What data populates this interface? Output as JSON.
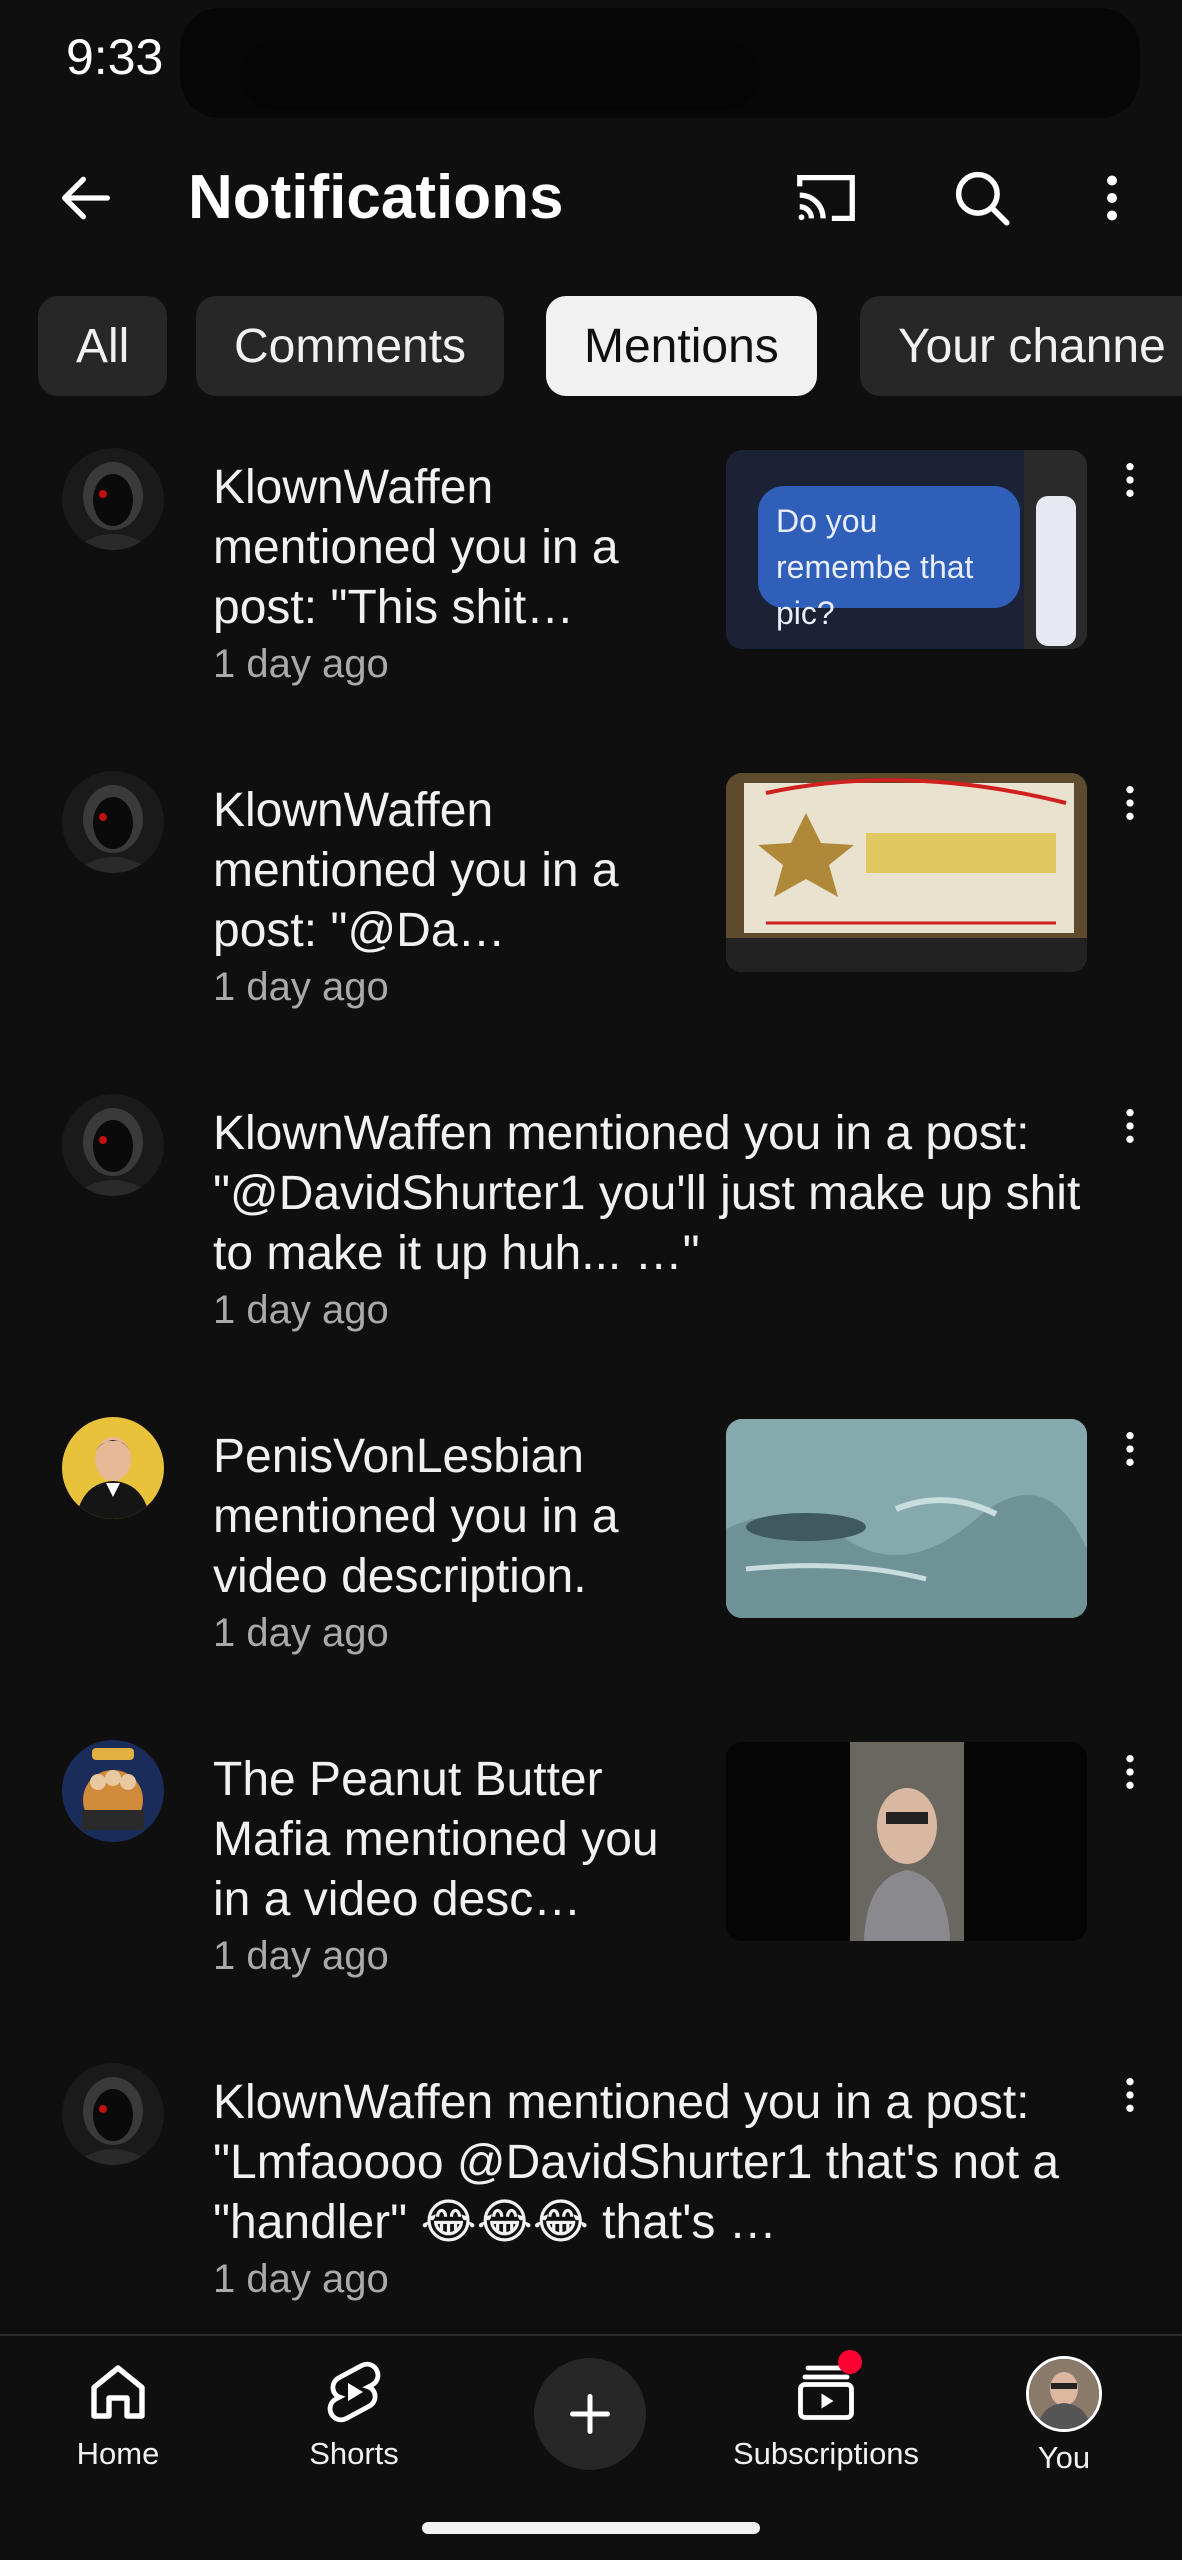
{
  "status_bar": {
    "time": "9:33"
  },
  "header": {
    "title": "Notifications",
    "icons": [
      "back-arrow-icon",
      "cast-icon",
      "search-icon",
      "more-vert-icon"
    ]
  },
  "tabs": [
    {
      "label": "All",
      "active": false
    },
    {
      "label": "Comments",
      "active": false
    },
    {
      "label": "Mentions",
      "active": true
    },
    {
      "label": "Your channe",
      "active": false
    }
  ],
  "notifications": [
    {
      "text": "KlownWaffen mentioned you in a post: \"This shit…",
      "time": "1 day ago",
      "thumbnail_text": "Do you remembe that pic?"
    },
    {
      "text": "KlownWaffen mentioned you in a post: \"@Da…",
      "time": "1 day ago"
    },
    {
      "text": "KlownWaffen mentioned you in a post: \"@DavidShurter1 you'll  just make up shit to make it up huh... …\"",
      "time": "1 day ago"
    },
    {
      "text": "PenisVonLesbian mentioned you in a video description.",
      "time": "1 day ago"
    },
    {
      "text": "The Peanut Butter Mafia mentioned you in a video desc…",
      "time": "1 day ago"
    },
    {
      "text": "KlownWaffen mentioned you in a post: \"Lmfaoooo @DavidShurter1 that's not a \"handler\" 😂😂😂 that's …",
      "time": "1 day ago"
    }
  ],
  "bottom_nav": {
    "home": "Home",
    "shorts": "Shorts",
    "subscriptions": "Subscriptions",
    "you": "You"
  },
  "colors": {
    "background": "#0f0f0f",
    "chip": "#272727",
    "chip_active": "#f1f1f1",
    "secondary_text": "#aaaaaa",
    "badge": "#ff0033"
  }
}
